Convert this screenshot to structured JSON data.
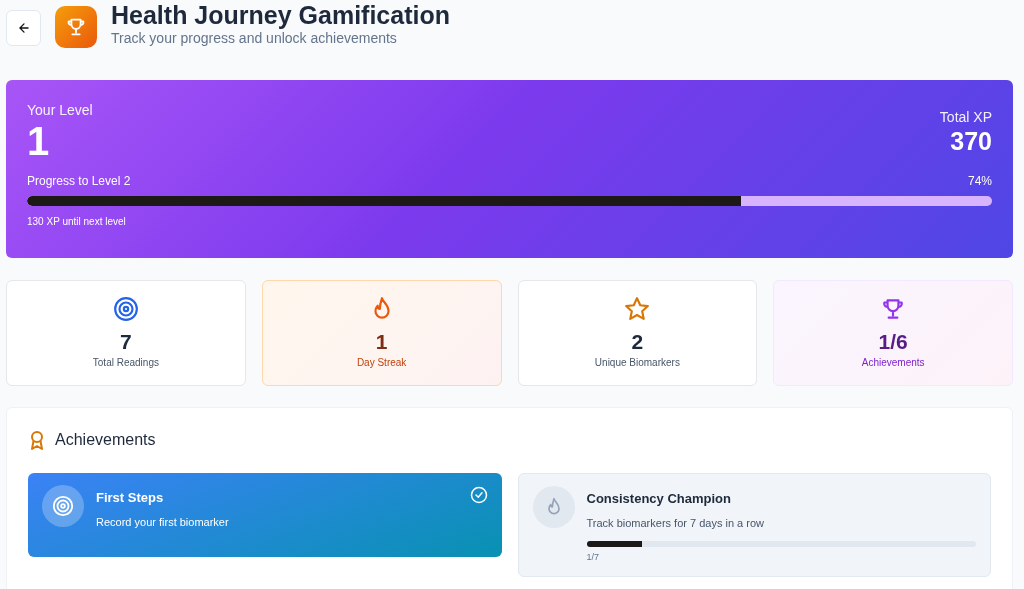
{
  "header": {
    "title": "Health Journey Gamification",
    "subtitle": "Track your progress and unlock achievements"
  },
  "level_card": {
    "level_label": "Your Level",
    "level": "1",
    "xp_label": "Total XP",
    "xp": "370",
    "progress_label": "Progress to Level 2",
    "percent": "74%",
    "progress": {
      "level": 0.74
    },
    "remaining": "130 XP until next level"
  },
  "stats": [
    {
      "kind": "target",
      "value": "7",
      "label": "Total Readings"
    },
    {
      "kind": "flame",
      "value": "1",
      "label": "Day Streak"
    },
    {
      "kind": "star",
      "value": "2",
      "label": "Unique Biomarkers"
    },
    {
      "kind": "trophy",
      "value": "1/6",
      "label": "Achievements"
    }
  ],
  "achievements": {
    "title": "Achievements",
    "items": [
      {
        "kind": "target",
        "name": "First Steps",
        "description": "Record your first biomarker",
        "unlocked": true
      },
      {
        "kind": "flame",
        "name": "Consistency Champion",
        "description": "Track biomarkers for 7 days in a row",
        "unlocked": false,
        "level": 0.143,
        "progress_text": "1/7"
      }
    ]
  }
}
